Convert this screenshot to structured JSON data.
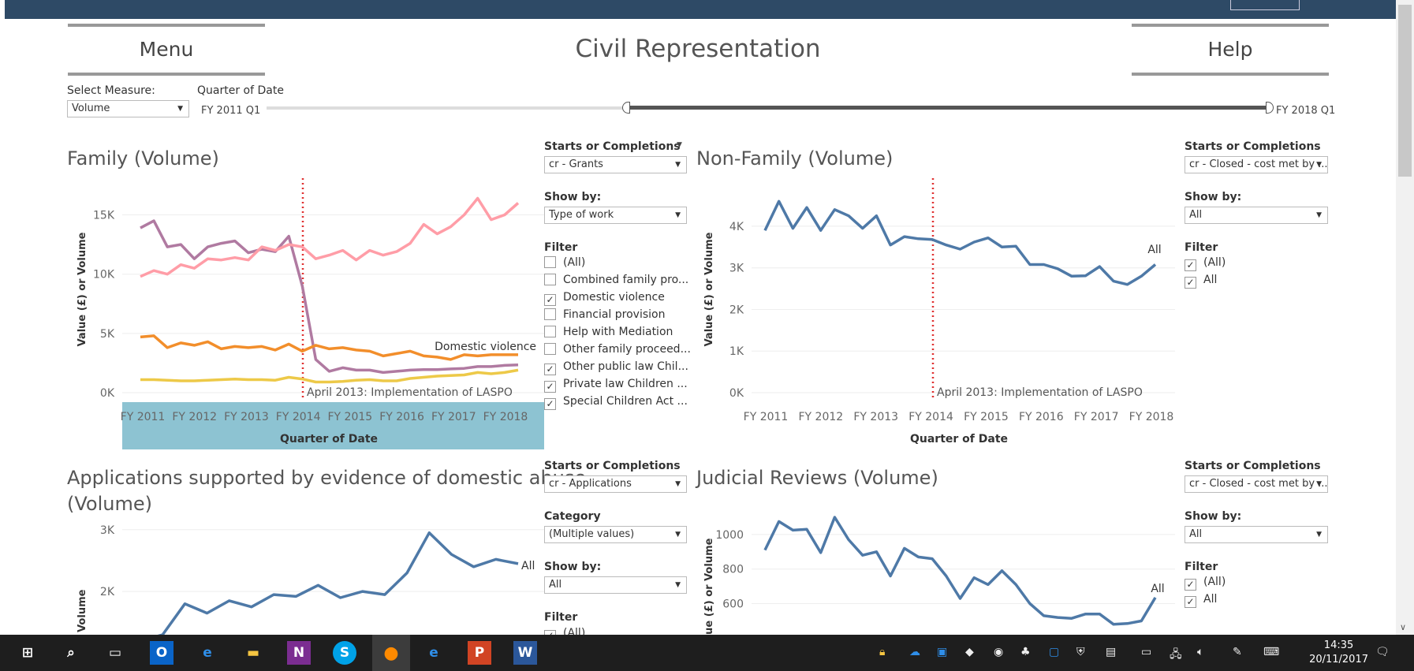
{
  "header": {
    "menu_label": "Menu",
    "help_label": "Help",
    "title": "Civil Representation"
  },
  "controls": {
    "measure_label": "Select Measure:",
    "measure_value": "Volume",
    "date_label": "Quarter of Date",
    "date_start": "FY 2011 Q1",
    "date_end": "FY 2018 Q1"
  },
  "family": {
    "title": "Family (Volume)",
    "soc_label": "Starts or Completions",
    "soc_value": "cr - Grants",
    "showby_label": "Show by:",
    "showby_value": "Type of work",
    "filter_label": "Filter",
    "filters": [
      {
        "label": "(All)",
        "checked": false
      },
      {
        "label": "Combined family pro...",
        "checked": false
      },
      {
        "label": "Domestic violence",
        "checked": true
      },
      {
        "label": "Financial provision",
        "checked": false
      },
      {
        "label": "Help with Mediation",
        "checked": false
      },
      {
        "label": "Other family proceed...",
        "checked": false
      },
      {
        "label": "Other public law Chil...",
        "checked": true
      },
      {
        "label": "Private law Children ...",
        "checked": true
      },
      {
        "label": "Special Children Act ...",
        "checked": true
      }
    ]
  },
  "nonfamily": {
    "title": "Non-Family (Volume)",
    "soc_label": "Starts or Completions",
    "soc_value": "cr - Closed - cost met by ...",
    "showby_label": "Show by:",
    "showby_value": "All",
    "filter_label": "Filter",
    "filters": [
      {
        "label": "(All)",
        "checked": true
      },
      {
        "label": "All",
        "checked": true
      }
    ]
  },
  "applications": {
    "title_line1": "Applications supported by evidence of domestic abuse",
    "title_line2": "(Volume)",
    "soc_label": "Starts or Completions",
    "soc_value": "cr - Applications",
    "category_label": "Category",
    "category_value": "(Multiple values)",
    "showby_label": "Show by:",
    "showby_value": "All",
    "filter_label": "Filter",
    "filter_partial": "(All)"
  },
  "judicial": {
    "title": "Judicial Reviews (Volume)",
    "soc_label": "Starts or Completions",
    "soc_value": "cr - Closed - cost met by ...",
    "showby_label": "Show by:",
    "showby_value": "All",
    "filter_label": "Filter",
    "filters": [
      {
        "label": "(All)",
        "checked": true
      },
      {
        "label": "All",
        "checked": true
      }
    ]
  },
  "chart_data": [
    {
      "type": "line",
      "title": "Family (Volume)",
      "xlabel": "Quarter of Date",
      "ylabel": "Value (£) or Volume",
      "x_ticks": [
        "FY 2011",
        "FY 2012",
        "FY 2013",
        "FY 2014",
        "FY 2015",
        "FY 2016",
        "FY 2017",
        "FY 2018"
      ],
      "y_ticks": [
        "0K",
        "5K",
        "10K",
        "15K"
      ],
      "ylim": [
        0,
        16500
      ],
      "annotation": "April 2013: Implementation of LASPO",
      "label": "Domestic violence",
      "series": [
        {
          "color": "#b07aa1",
          "values": [
            13900,
            14500,
            12300,
            12500,
            11300,
            12300,
            12600,
            12800,
            11800,
            12100,
            11900,
            13200,
            9000,
            2800,
            1800,
            2100,
            1900,
            1900,
            1700,
            1800,
            1900,
            1950,
            1950,
            2000,
            2050,
            2200,
            2200,
            2300,
            2350
          ]
        },
        {
          "color": "#ff9da7",
          "values": [
            9800,
            10300,
            10000,
            10800,
            10500,
            11300,
            11200,
            11400,
            11200,
            12300,
            12000,
            12500,
            12300,
            11300,
            11600,
            12000,
            11200,
            12000,
            11600,
            11900,
            12600,
            14200,
            13400,
            14000,
            15000,
            16400,
            14600,
            15000,
            16000
          ]
        },
        {
          "color": "#f28e2b",
          "values": [
            4700,
            4800,
            3800,
            4200,
            4000,
            4300,
            3700,
            3900,
            3800,
            3900,
            3600,
            4100,
            3500,
            4000,
            3700,
            3800,
            3600,
            3500,
            3100,
            3300,
            3500,
            3100,
            3000,
            2800,
            3200,
            3100,
            3200,
            3200,
            3200
          ]
        },
        {
          "color": "#edc948",
          "values": [
            1100,
            1100,
            1050,
            1000,
            1000,
            1050,
            1100,
            1150,
            1100,
            1100,
            1050,
            1300,
            1150,
            900,
            900,
            950,
            1050,
            1100,
            1000,
            1000,
            1200,
            1300,
            1400,
            1450,
            1500,
            1700,
            1600,
            1700,
            1900
          ]
        }
      ]
    },
    {
      "type": "line",
      "title": "Non-Family (Volume)",
      "xlabel": "Quarter of Date",
      "ylabel": "Value (£) or Volume",
      "x_ticks": [
        "FY 2011",
        "FY 2012",
        "FY 2013",
        "FY 2014",
        "FY 2015",
        "FY 2016",
        "FY 2017",
        "FY 2018"
      ],
      "y_ticks": [
        "0K",
        "1K",
        "2K",
        "3K",
        "4K"
      ],
      "ylim": [
        0,
        4700
      ],
      "annotation": "April 2013: Implementation of LASPO",
      "label": "All",
      "series": [
        {
          "color": "#4e79a7",
          "values": [
            3900,
            4600,
            3950,
            4450,
            3900,
            4400,
            4250,
            3950,
            4250,
            3550,
            3750,
            3700,
            3680,
            3550,
            3450,
            3620,
            3720,
            3500,
            3520,
            3080,
            3080,
            2980,
            2800,
            2810,
            3030,
            2680,
            2600,
            2800,
            3080
          ]
        }
      ]
    },
    {
      "type": "line",
      "title": "Applications supported by evidence of domestic abuse (Volume)",
      "ylabel": "Value (£) or Volume",
      "y_ticks": [
        "2K",
        "3K"
      ],
      "label": "All",
      "series": [
        {
          "color": "#4e79a7",
          "values": [
            1200,
            1300,
            1800,
            1650,
            1850,
            1750,
            1950,
            1920,
            2100,
            1900,
            2000,
            1950,
            2300,
            2950,
            2600,
            2400,
            2520,
            2450
          ]
        }
      ]
    },
    {
      "type": "line",
      "title": "Judicial Reviews (Volume)",
      "ylabel": "Value (£) or Volume",
      "y_ticks": [
        "600",
        "800",
        "1000"
      ],
      "label": "All",
      "series": [
        {
          "color": "#4e79a7",
          "values": [
            910,
            1075,
            1025,
            1030,
            895,
            1100,
            970,
            880,
            900,
            760,
            920,
            870,
            860,
            760,
            630,
            750,
            710,
            790,
            710,
            600,
            530,
            520,
            515,
            540,
            540,
            480,
            485,
            500,
            635
          ]
        }
      ]
    }
  ],
  "taskbar": {
    "time": "14:35",
    "date": "20/11/2017"
  }
}
